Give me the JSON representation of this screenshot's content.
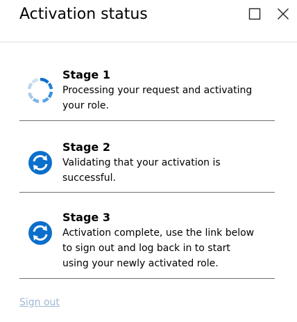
{
  "dialog": {
    "title": "Activation status"
  },
  "window_controls": {
    "maximize_icon": "maximize-icon",
    "close_icon": "close-icon"
  },
  "stages": [
    {
      "name": "Stage 1",
      "description_lines": [
        "Processing your request and activating",
        "your role."
      ],
      "icon": "spinner-icon",
      "state": "in-progress"
    },
    {
      "name": "Stage 2",
      "description_lines": [
        "Validating that your activation is",
        "successful."
      ],
      "icon": "refresh-icon",
      "state": "pending"
    },
    {
      "name": "Stage 3",
      "description_lines": [
        "Activation complete, use the link below",
        "to sign out and log back in to start",
        "using your newly activated role."
      ],
      "icon": "refresh-icon",
      "state": "pending"
    }
  ],
  "footer": {
    "sign_out_label": "Sign out",
    "sign_out_enabled": false
  },
  "colors": {
    "accent": "#0b6fcb",
    "spinner_light": "#a9c8ea",
    "link_disabled": "#9fb8d2",
    "divider": "#6f6f6f"
  }
}
